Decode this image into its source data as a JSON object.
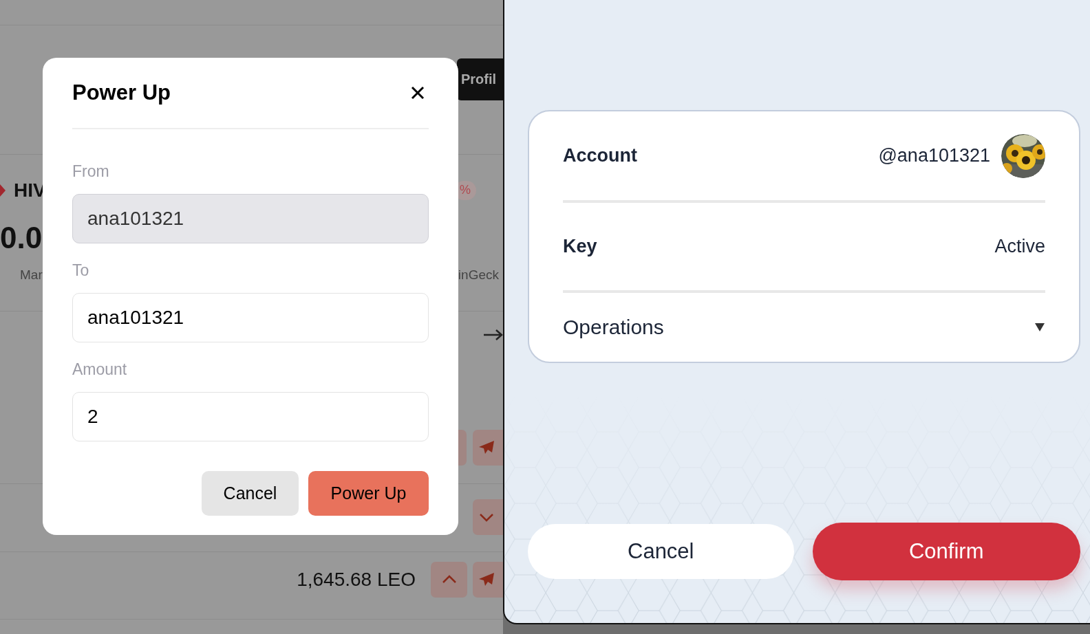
{
  "background_page": {
    "profile_button": "Profil",
    "token": {
      "symbol": "HIV",
      "change": "%",
      "price": "0.0",
      "market_label": "Mar",
      "source_label": "inGeck"
    },
    "balance": "1,645.68 LEO"
  },
  "power_up_dialog": {
    "title": "Power Up",
    "fields": [
      {
        "label": "From",
        "value": "ana101321",
        "disabled": true
      },
      {
        "label": "To",
        "value": "ana101321",
        "disabled": false
      },
      {
        "label": "Amount",
        "value": "2",
        "disabled": false
      }
    ],
    "buttons": [
      {
        "label": "Cancel",
        "kind": "secondary"
      },
      {
        "label": "Power Up",
        "kind": "primary"
      }
    ]
  },
  "confirm_panel": {
    "rows": [
      {
        "kind": "account",
        "label": "Account",
        "value": "@ana101321"
      },
      {
        "kind": "key",
        "label": "Key",
        "value": "Active"
      },
      {
        "kind": "dropdown",
        "label": "Operations",
        "expanded": false
      }
    ],
    "buttons": [
      {
        "label": "Cancel",
        "kind": "secondary"
      },
      {
        "label": "Confirm",
        "kind": "primary"
      }
    ]
  }
}
